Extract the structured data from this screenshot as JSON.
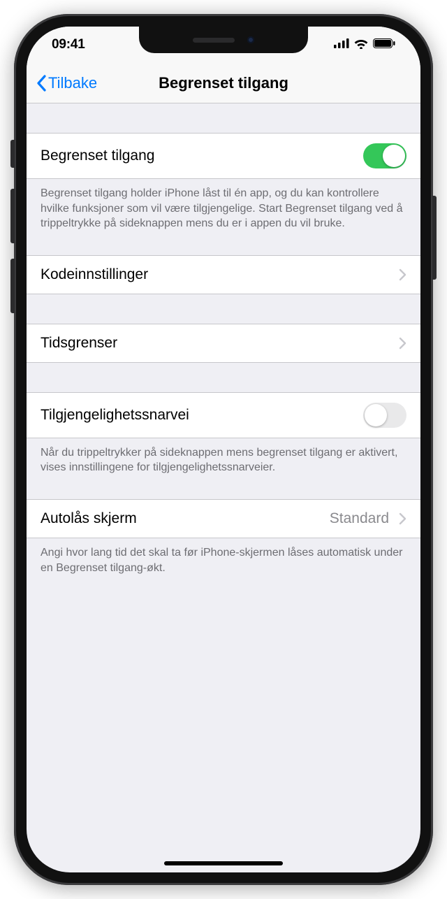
{
  "statusBar": {
    "time": "09:41"
  },
  "nav": {
    "back": "Tilbake",
    "title": "Begrenset tilgang"
  },
  "group1": {
    "label": "Begrenset tilgang",
    "enabled": true,
    "footer": "Begrenset tilgang holder iPhone låst til én app, og du kan kontrollere hvilke funksjoner som vil være tilgjengelige. Start Begrenset tilgang ved å trippeltrykke på sideknappen mens du er i appen du vil bruke."
  },
  "group2": {
    "label": "Kodeinnstillinger"
  },
  "group3": {
    "label": "Tidsgrenser"
  },
  "group4": {
    "label": "Tilgjengelighetssnarvei",
    "enabled": false,
    "footer": "Når du trippeltrykker på sideknappen mens begrenset tilgang er aktivert, vises innstillingene for tilgjengelighetssnarveier."
  },
  "group5": {
    "label": "Autolås skjerm",
    "value": "Standard",
    "footer": "Angi hvor lang tid det skal ta før iPhone-skjermen låses automatisk under en Begrenset tilgang-økt."
  }
}
